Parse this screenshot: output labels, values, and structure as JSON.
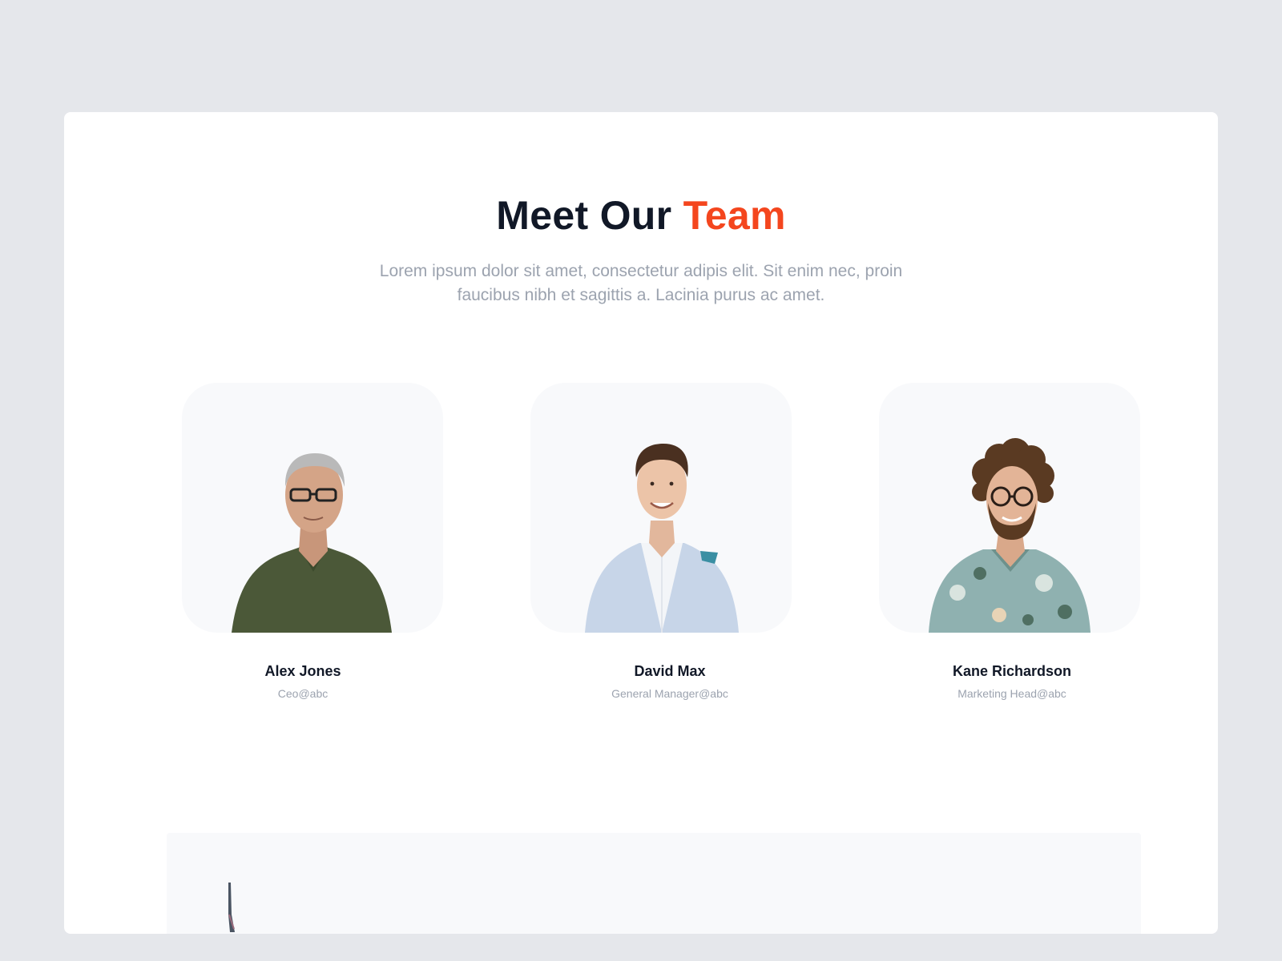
{
  "section": {
    "title_main": "Meet Our",
    "title_accent": "Team",
    "description": "Lorem ipsum dolor sit amet, consectetur adipis elit. Sit enim nec, proin faucibus nibh et sagittis a. Lacinia purus ac amet."
  },
  "team": [
    {
      "name": "Alex Jones",
      "role": "Ceo@abc"
    },
    {
      "name": "David Max",
      "role": "General Manager@abc"
    },
    {
      "name": "Kane Richardson",
      "role": "Marketing Head@abc"
    }
  ],
  "colors": {
    "page_background": "#e5e7eb",
    "card_background": "#ffffff",
    "heading": "#111827",
    "accent": "#f4461e",
    "muted_text": "#9ca3af",
    "photo_background": "#f8f9fb"
  }
}
